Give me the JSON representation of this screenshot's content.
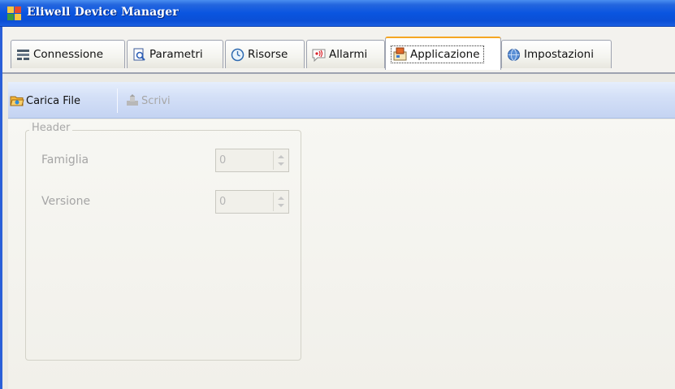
{
  "window": {
    "title": "Eliwell Device Manager",
    "icon": "app-grid-icon"
  },
  "tabs": [
    {
      "label": "Connessione",
      "icon": "connection-grid-icon",
      "active": false
    },
    {
      "label": "Parametri",
      "icon": "magnifier-document-icon",
      "active": false
    },
    {
      "label": "Risorse",
      "icon": "clock-icon",
      "active": false
    },
    {
      "label": "Allarmi",
      "icon": "alarm-speech-icon",
      "active": false
    },
    {
      "label": "Applicazione",
      "icon": "application-package-icon",
      "active": true
    },
    {
      "label": "Impostazioni",
      "icon": "globe-settings-icon",
      "active": false
    }
  ],
  "toolbar": {
    "load_label": "Carica File",
    "load_icon": "folder-open-icon",
    "write_label": "Scrivi",
    "write_icon": "write-device-icon",
    "write_enabled": false
  },
  "header_group": {
    "legend": "Header",
    "fields": [
      {
        "label": "Famiglia",
        "value": "0"
      },
      {
        "label": "Versione",
        "value": "0"
      }
    ]
  },
  "colors": {
    "titlebar": "#0a55e0",
    "active_tab_accent": "#f5a623",
    "toolbar": "#d4e0f7"
  }
}
